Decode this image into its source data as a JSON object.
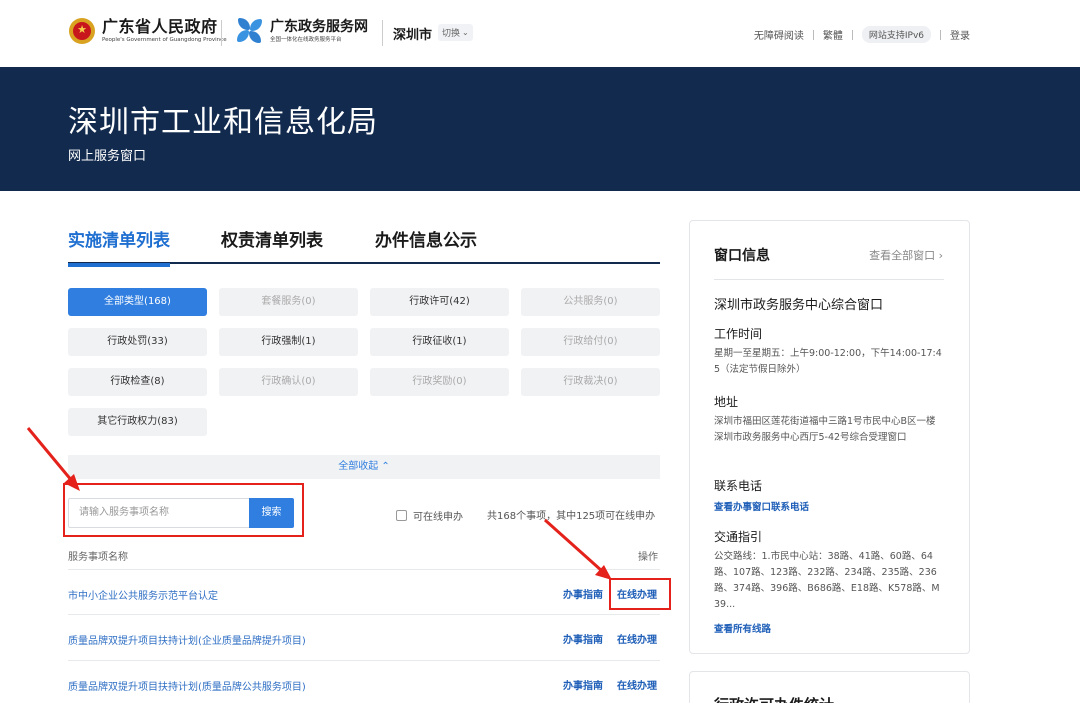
{
  "header": {
    "gov_name": "广东省人民政府",
    "gov_en": "People's Government of Guangdong Province",
    "service_name": "广东政务服务网",
    "service_sub": "全国一体化在线政务服务平台",
    "city": "深圳市",
    "switch_label": "切换",
    "links": [
      "无障碍阅读",
      "繁體",
      "网站支持IPv6",
      "登录"
    ]
  },
  "banner": {
    "title": "深圳市工业和信息化局",
    "subtitle": "网上服务窗口"
  },
  "tabs": [
    {
      "label": "实施清单列表",
      "active": true
    },
    {
      "label": "权责清单列表",
      "active": false
    },
    {
      "label": "办件信息公示",
      "active": false
    }
  ],
  "categories": [
    {
      "label": "全部类型(168)",
      "state": "active"
    },
    {
      "label": "套餐服务(0)",
      "state": "disabled"
    },
    {
      "label": "行政许可(42)",
      "state": "normal"
    },
    {
      "label": "公共服务(0)",
      "state": "disabled"
    },
    {
      "label": "行政处罚(33)",
      "state": "normal"
    },
    {
      "label": "行政强制(1)",
      "state": "normal"
    },
    {
      "label": "行政征收(1)",
      "state": "normal"
    },
    {
      "label": "行政给付(0)",
      "state": "disabled"
    },
    {
      "label": "行政检查(8)",
      "state": "normal"
    },
    {
      "label": "行政确认(0)",
      "state": "disabled"
    },
    {
      "label": "行政奖励(0)",
      "state": "disabled"
    },
    {
      "label": "行政裁决(0)",
      "state": "disabled"
    },
    {
      "label": "其它行政权力(83)",
      "state": "normal"
    }
  ],
  "collapse_label": "全部收起",
  "search": {
    "placeholder": "请输入服务事项名称",
    "button": "搜索",
    "online_only_label": "可在线申办",
    "count_text": "共168个事项，其中125项可在线申办"
  },
  "table": {
    "col_name": "服务事项名称",
    "col_action": "操作",
    "rows": [
      {
        "name": "市中小企业公共服务示范平台认定",
        "guide": "办事指南",
        "online": "在线办理"
      },
      {
        "name": "质量品牌双提升项目扶持计划(企业质量品牌提升项目)",
        "guide": "办事指南",
        "online": "在线办理"
      },
      {
        "name": "质量品牌双提升项目扶持计划(质量品牌公共服务项目)",
        "guide": "办事指南",
        "online": "在线办理"
      }
    ]
  },
  "sidebar": {
    "title": "窗口信息",
    "more": "查看全部窗口",
    "window_name": "深圳市政务服务中心综合窗口",
    "hours_label": "工作时间",
    "hours_text": "星期一至星期五：上午9:00-12:00，下午14:00-17:45（法定节假日除外）",
    "address_label": "地址",
    "address_text": "深圳市福田区莲花街道福中三路1号市民中心B区一楼深圳市政务服务中心西厅5-42号综合受理窗口",
    "phone_label": "联系电话",
    "phone_link": "查看办事窗口联系电话",
    "traffic_label": "交通指引",
    "traffic_text": "公交路线：1.市民中心站：38路、41路、60路、64路、107路、123路、232路、234路、235路、236路、374路、396路、B686路、E18路、K578路、M39...",
    "traffic_link": "查看所有线路",
    "card2_title": "行政许可办件统计"
  },
  "colors": {
    "banner_bg": "#122a4e",
    "accent_blue": "#2f7ee0",
    "annotation_red": "#e4211b"
  }
}
